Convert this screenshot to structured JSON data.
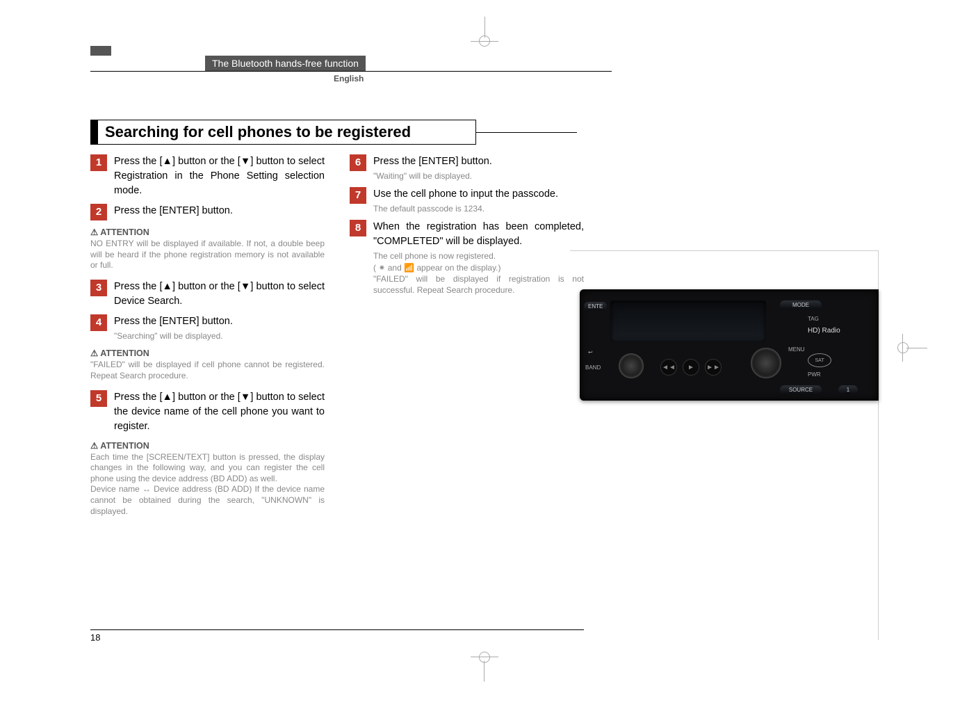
{
  "header": {
    "section_label": "The Bluetooth hands-free function",
    "language": "English"
  },
  "title": "Searching for cell phones to be registered",
  "left_column": {
    "step1": {
      "num": "1",
      "text": "Press the [▲] button or the [▼] button to select Registration in the Phone Setting selection mode."
    },
    "step2": {
      "num": "2",
      "text": "Press the [ENTER] button."
    },
    "att1": {
      "head": "ATTENTION",
      "body": "NO ENTRY will be displayed if available. If not, a double beep will be heard if the phone registration memory is not available or full."
    },
    "step3": {
      "num": "3",
      "text": "Press the [▲] button or the [▼] button to select Device Search."
    },
    "step4": {
      "num": "4",
      "text": "Press the [ENTER] button.",
      "sub": "\"Searching\" will be displayed."
    },
    "att2": {
      "head": "ATTENTION",
      "body": "\"FAILED\" will be displayed if cell phone cannot be registered. Repeat Search procedure."
    },
    "step5": {
      "num": "5",
      "text": "Press the [▲] button or the [▼] button to select the device name of the cell phone you want to register."
    },
    "att3": {
      "head": "ATTENTION",
      "body": "Each time the [SCREEN/TEXT] button is pressed, the display changes in the following way, and you can register the cell phone using the device address (BD ADD) as well.\nDevice name ↔ Device address (BD ADD) If the device name cannot be obtained during the search, \"UNKNOWN\" is displayed."
    }
  },
  "right_column": {
    "step6": {
      "num": "6",
      "text": "Press the [ENTER] button.",
      "sub": "\"Waiting\" will be displayed."
    },
    "step7": {
      "num": "7",
      "text": "Use the cell phone to input the passcode.",
      "sub": "The default passcode is 1234."
    },
    "step8": {
      "num": "8",
      "text": "When the registration has been completed, \"COMPLETED\" will be displayed.",
      "sub": "The cell phone is now registered.\n( ⁕ and 📶 appear on the display.)\n\"FAILED\" will be displayed if registration is not successful. Repeat Search procedure."
    }
  },
  "device": {
    "btn_ente": "ENTE",
    "btn_mode": "MODE",
    "btn_source": "SOURCE",
    "lbl_tag": "TAG",
    "hd": "HD) Radio",
    "sat": "SAT",
    "lbl_pwr": "PWR",
    "lbl_band": "BAND",
    "lbl_menu": "MENU",
    "prev": "◄◄",
    "play": "►",
    "next": "►►",
    "one": "1"
  },
  "page_number": "18"
}
